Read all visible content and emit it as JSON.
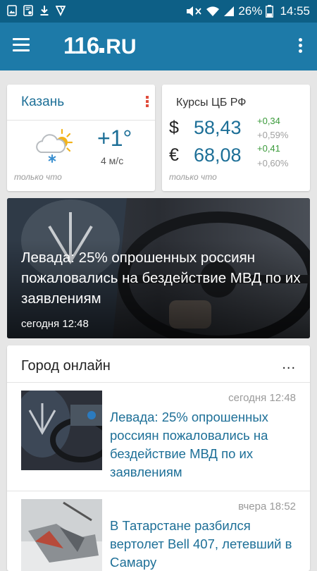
{
  "status_bar": {
    "battery": "26%",
    "time": "14:55"
  },
  "app_bar": {
    "logo_main": "116",
    "logo_suffix": "RU"
  },
  "weather": {
    "city": "Казань",
    "temperature": "+1°",
    "wind": "4 м/с",
    "updated": "только что",
    "icon": "cloud-sun-snow-icon"
  },
  "rates": {
    "title": "Курсы ЦБ РФ",
    "usd": {
      "symbol": "$",
      "value": "58,43",
      "change": "+0,34",
      "change_pct": "+0,59%"
    },
    "eur": {
      "symbol": "€",
      "value": "68,08",
      "change": "+0,41",
      "change_pct": "+0,60%"
    },
    "updated": "только что"
  },
  "hero": {
    "title": "Левада: 25% опрошенных россиян пожаловались на бездействие МВД по их заявлениям",
    "time": "сегодня 12:48"
  },
  "feed": {
    "title": "Город онлайн",
    "more": "...",
    "items": [
      {
        "time": "сегодня 12:48",
        "title": "Левада: 25% опрошенных россиян пожаловались на бездействие МВД по их заявлениям"
      },
      {
        "time": "вчера 18:52",
        "title": "В Татарстане разбился вертолет Bell 407, летевший в Самару"
      }
    ]
  },
  "colors": {
    "status_bar": "#0d5f86",
    "app_bar": "#1d7aa8",
    "accent_text": "#1d6f97",
    "positive": "#3a9a3a"
  }
}
